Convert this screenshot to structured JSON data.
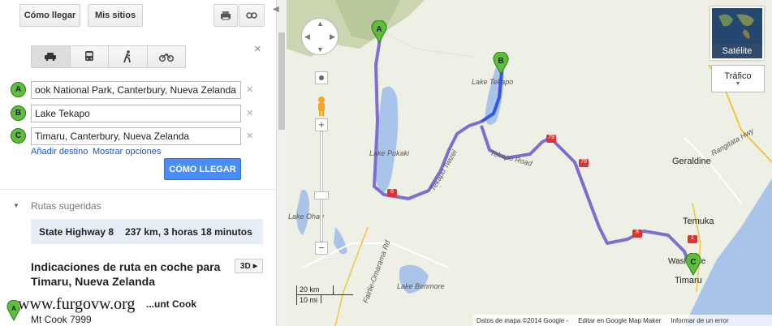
{
  "toolbar": {
    "directions_label": "Cómo llegar",
    "my_places_label": "Mis sitios"
  },
  "waypoints": [
    {
      "marker": "A",
      "value": "ook National Park, Canterbury, Nueva Zelanda"
    },
    {
      "marker": "B",
      "value": "Lake Tekapo"
    },
    {
      "marker": "C",
      "value": "Timaru, Canterbury, Nueva Zelanda"
    }
  ],
  "links": {
    "add_destination": "Añadir destino",
    "show_options": "Mostrar opciones"
  },
  "go_button": "CÓMO LLEGAR",
  "suggested_routes": {
    "header": "Rutas sugeridas",
    "route_name": "State Highway 8",
    "route_summary": "237 km, 3 horas 18 minutos"
  },
  "directions": {
    "title": "Indicaciones de ruta en coche para Timaru, Nueva Zelanda",
    "button_3d": "3D",
    "step_text": "...unt Cook",
    "step_subtext": "Mt Cook 7999"
  },
  "watermark": "www.furgovw.org",
  "map": {
    "satellite_label": "Satélite",
    "traffic_label": "Tráfico",
    "scale_km": "20 km",
    "scale_mi": "10 mi",
    "footer_data": "Datos de mapa ©2014 Google -",
    "footer_edit": "Editar en Google Map Maker",
    "footer_report": "Informar de un error",
    "labels": {
      "lake_pukaki": "Lake Pukaki",
      "lake_tekapo": "Lake Tekapo",
      "lake_ohau": "Lake Ohau",
      "lake_benmore": "Lake Benmore",
      "tekapo_road": "Tekapo Road",
      "tekapo_twizel": "Tekapo Twizel",
      "fairlie_omarama": "Fairlie-Omarama Rd",
      "geraldine": "Geraldine",
      "temuka": "Temuka",
      "timaru": "Timaru",
      "washdyke": "Washdyke",
      "rangitata": "Rangitata Hwy"
    },
    "markers": [
      "A",
      "B",
      "C"
    ],
    "highway_shields": [
      "8",
      "79",
      "79",
      "8",
      "1"
    ],
    "colors": {
      "route": "#7b6fd1",
      "route_highlight": "#3355e8",
      "water": "#a9c4e8",
      "marker": "#5fbd3a"
    }
  }
}
